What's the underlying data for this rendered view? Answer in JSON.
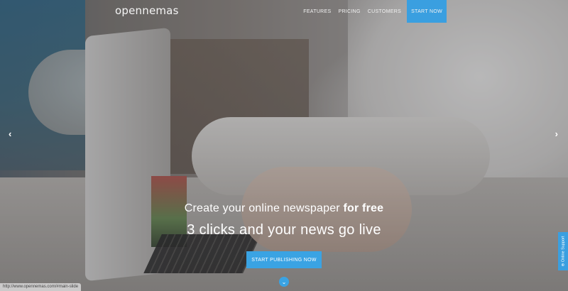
{
  "header": {
    "logo_text": "opennemas",
    "nav": [
      {
        "label": "FEATURES"
      },
      {
        "label": "PRICING"
      },
      {
        "label": "CUSTOMERS"
      }
    ],
    "cta_label": "START NOW"
  },
  "hero": {
    "line1_regular": "Create your online newspaper ",
    "line1_bold": "for free",
    "line2": "3 clicks and your news go live",
    "button_label": "START PUBLISHING NOW",
    "prev_arrow": "‹",
    "next_arrow": "›",
    "scroll_icon": "⌄"
  },
  "status_bar": {
    "url": "http://www.opennemas.com/#main-slide"
  },
  "support": {
    "label": "⊕ Online Support"
  },
  "colors": {
    "accent": "#3aa3e3",
    "text": "#ffffff"
  },
  "icons": [
    "chevron-left-icon",
    "chevron-right-icon",
    "chevron-down-icon"
  ]
}
